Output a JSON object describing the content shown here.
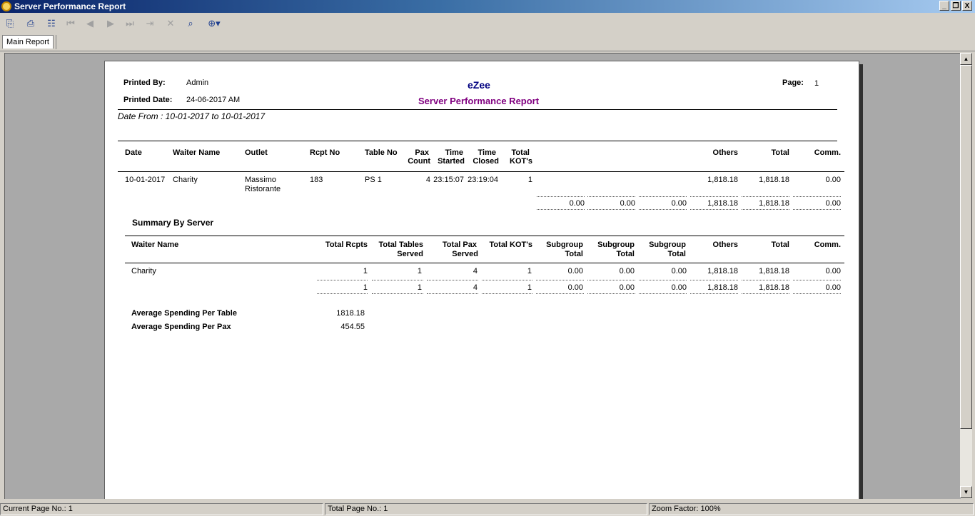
{
  "window": {
    "title": "Server Performance Report",
    "buttons": {
      "minimize": "_",
      "restore": "❐",
      "close": "X"
    }
  },
  "toolbar": {
    "icons": [
      "export-icon",
      "print-icon",
      "group-tree-icon",
      "first-page-icon",
      "prev-page-icon",
      "next-page-icon",
      "last-page-icon",
      "goto-page-icon",
      "stop-icon",
      "search-icon",
      "zoom-icon"
    ]
  },
  "tabs": [
    {
      "label": "Main Report"
    }
  ],
  "report": {
    "printed_by_label": "Printed By:",
    "printed_by": "Admin",
    "printed_date_label": "Printed Date:",
    "printed_date": "24-06-2017 AM",
    "company": "eZee",
    "title": "Server Performance Report",
    "page_label": "Page:",
    "page": "1",
    "date_range": "Date From : 10-01-2017 to 10-01-2017",
    "detail_headers": {
      "date": "Date",
      "waiter": "Waiter Name",
      "outlet": "Outlet",
      "rcpt": "Rcpt No",
      "table": "Table No",
      "pax1": "Pax",
      "pax2": "Count",
      "ts1": "Time",
      "ts2": "Started",
      "tc1": "Time",
      "tc2": "Closed",
      "kot1": "Total",
      "kot2": "KOT's",
      "others": "Others",
      "total": "Total",
      "comm": "Comm."
    },
    "detail_row": {
      "date": "10-01-2017",
      "waiter": "Charity",
      "outlet1": "Massimo",
      "outlet2": "Ristorante",
      "rcpt": "183",
      "table": "PS 1",
      "pax": "4",
      "started": "23:15:07",
      "closed": "23:19:04",
      "kot": "1",
      "others": "1,818.18",
      "total": "1,818.18",
      "comm": "0.00"
    },
    "detail_totals": [
      "0.00",
      "0.00",
      "0.00",
      "1,818.18",
      "1,818.18",
      "0.00"
    ],
    "summary_title": "Summary By Server",
    "summary_headers": {
      "waiter": "Waiter Name",
      "rcpts": "Total Rcpts",
      "tables1": "Total Tables",
      "tables2": "Served",
      "pax1": "Total Pax",
      "pax2": "Served",
      "kots": "Total KOT's",
      "sg1a": "Subgroup",
      "sg1b": "Total",
      "sg2a": "Subgroup",
      "sg2b": "Total",
      "sg3a": "Subgroup",
      "sg3b": "Total",
      "others": "Others",
      "total": "Total",
      "comm": "Comm."
    },
    "summary_row": {
      "waiter": "Charity",
      "values": [
        "1",
        "1",
        "4",
        "1",
        "0.00",
        "0.00",
        "0.00",
        "1,818.18",
        "1,818.18",
        "0.00"
      ]
    },
    "summary_totals": [
      "1",
      "1",
      "4",
      "1",
      "0.00",
      "0.00",
      "0.00",
      "1,818.18",
      "1,818.18",
      "0.00"
    ],
    "avg_table_label": "Average Spending Per Table",
    "avg_table": "1818.18",
    "avg_pax_label": "Average Spending Per Pax",
    "avg_pax": "454.55"
  },
  "colors": {
    "company": "#000080",
    "title": "#800080"
  },
  "status": {
    "current_page": "Current Page No.: 1",
    "total_page": "Total Page No.: 1",
    "zoom": "Zoom Factor: 100%"
  }
}
